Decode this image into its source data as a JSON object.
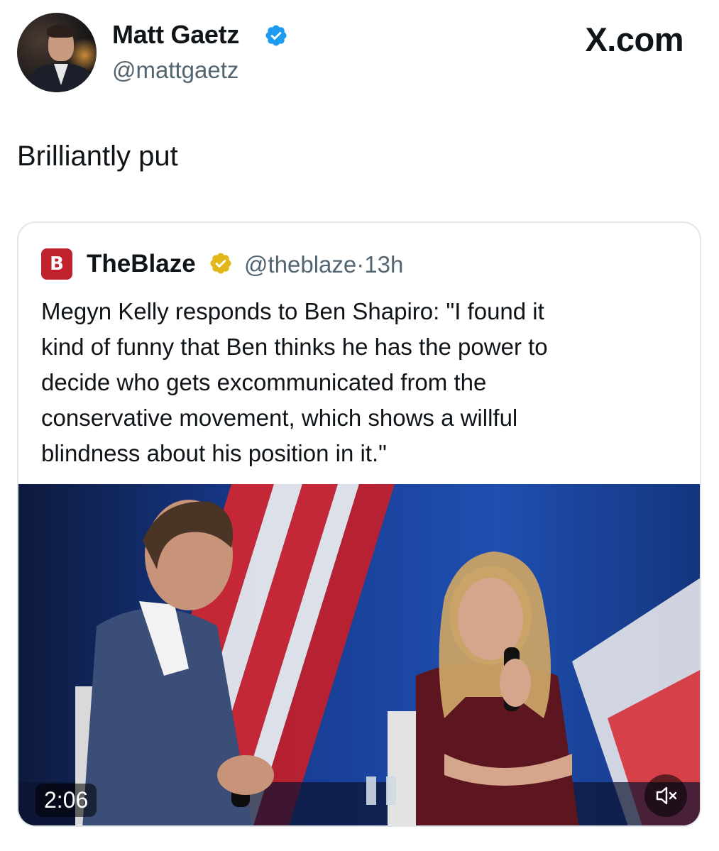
{
  "header": {
    "author_name": "Matt Gaetz",
    "author_handle": "@mattgaetz",
    "brand": "X.com"
  },
  "tweet": {
    "text": "Brilliantly put"
  },
  "quoted_tweet": {
    "name": "TheBlaze",
    "handle": "@theblaze",
    "separator": "·",
    "time": "13h",
    "logo_letter": "B",
    "text_lines": [
      "Megyn Kelly responds to Ben Shapiro: \"I found it",
      "kind of funny that Ben thinks he has the power to",
      "decide who gets excommunicated from the",
      "conservative movement, which shows a willful",
      "blindness about his position in it.\""
    ],
    "video": {
      "duration": "2:06"
    }
  },
  "icons": {
    "verified": "verified-badge-icon",
    "gold_verified": "gold-verified-badge-icon",
    "mute": "speaker-muted-icon"
  },
  "colors": {
    "verified_blue": "#1d9bf0",
    "gold": "#e2b719",
    "blaze_red": "#c0212d",
    "secondary_text": "#536471"
  }
}
